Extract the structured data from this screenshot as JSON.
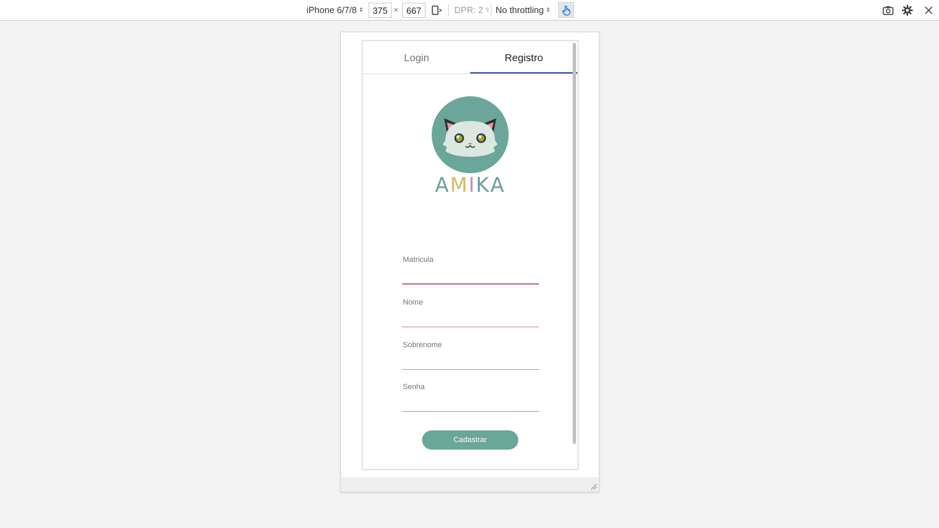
{
  "devtools": {
    "device": "iPhone 6/7/8",
    "width": "375",
    "height": "667",
    "times": "×",
    "dpr": "DPR: 2",
    "throttling": "No throttling",
    "icons": [
      "rotate-icon",
      "touch-icon",
      "screenshot-icon",
      "settings-icon",
      "close-icon"
    ]
  },
  "app": {
    "tabs": [
      {
        "label": "Login",
        "active": false
      },
      {
        "label": "Registro",
        "active": true
      }
    ],
    "brand": {
      "letters": [
        "A",
        "M",
        "I",
        "K",
        "A"
      ],
      "colors": [
        "#6a9da0",
        "#d8b86a",
        "#d08aa5",
        "#6a9da0",
        "#6a9da0"
      ]
    },
    "form": {
      "fields": [
        {
          "label": "Matricula"
        },
        {
          "label": "Nome"
        },
        {
          "label": "Sobrenome"
        },
        {
          "label": "Senha"
        }
      ],
      "submit_label": "Cadastrar"
    },
    "colors": {
      "tab_indicator": "#3f51b5",
      "field_underline": "#d08aa5",
      "button": "#6aa699",
      "logo_circle": "#6aa699"
    }
  }
}
